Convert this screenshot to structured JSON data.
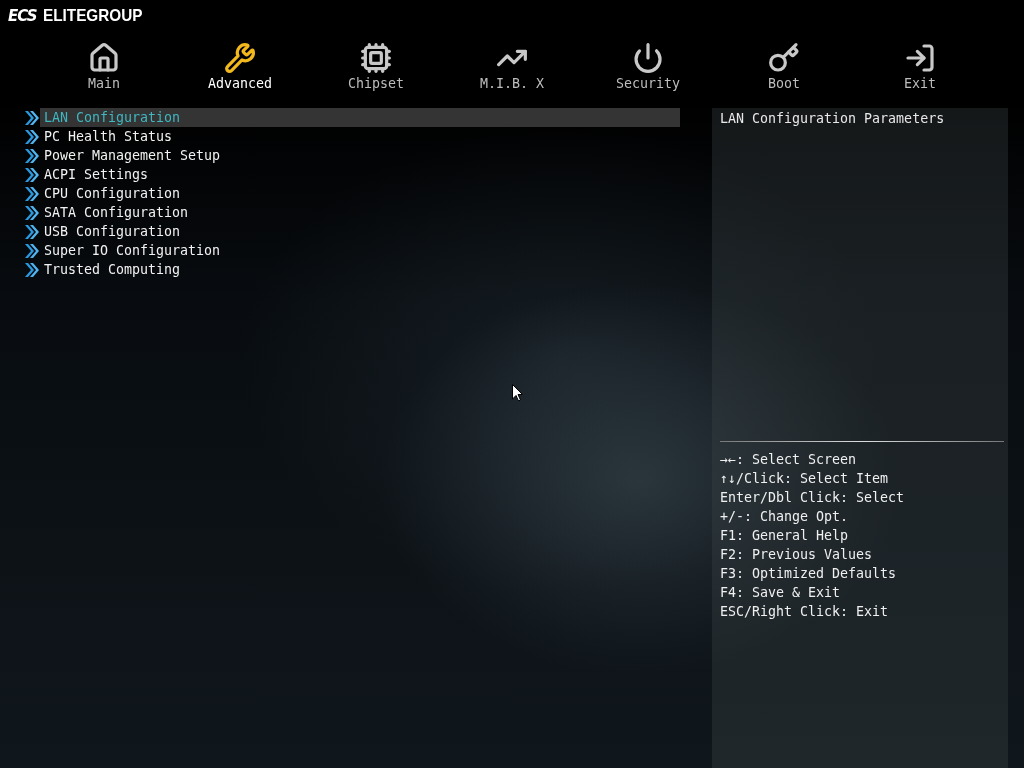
{
  "logo": {
    "mark": "ECS",
    "name": "ELITEGROUP"
  },
  "tabs": [
    {
      "label": "Main",
      "kind": "home",
      "selected": false
    },
    {
      "label": "Advanced",
      "kind": "wrench",
      "selected": true
    },
    {
      "label": "Chipset",
      "kind": "chip",
      "selected": false
    },
    {
      "label": "M.I.B. X",
      "kind": "chart",
      "selected": false
    },
    {
      "label": "Security",
      "kind": "power",
      "selected": false
    },
    {
      "label": "Boot",
      "kind": "key",
      "selected": false
    },
    {
      "label": "Exit",
      "kind": "exit",
      "selected": false
    }
  ],
  "menu": [
    {
      "label": "LAN Configuration",
      "selected": true
    },
    {
      "label": "PC Health Status",
      "selected": false
    },
    {
      "label": "Power Management Setup",
      "selected": false
    },
    {
      "label": "ACPI Settings",
      "selected": false
    },
    {
      "label": "CPU Configuration",
      "selected": false
    },
    {
      "label": "SATA Configuration",
      "selected": false
    },
    {
      "label": "USB Configuration",
      "selected": false
    },
    {
      "label": "Super IO Configuration",
      "selected": false
    },
    {
      "label": "Trusted Computing",
      "selected": false
    }
  ],
  "help_panel": {
    "description": "LAN Configuration Parameters",
    "keys": [
      "→←: Select Screen",
      "↑↓/Click: Select Item",
      "Enter/Dbl Click: Select",
      "+/-: Change Opt.",
      "F1: General Help",
      "F2: Previous Values",
      "F3: Optimized Defaults",
      "F4: Save & Exit",
      "ESC/Right Click: Exit"
    ]
  }
}
